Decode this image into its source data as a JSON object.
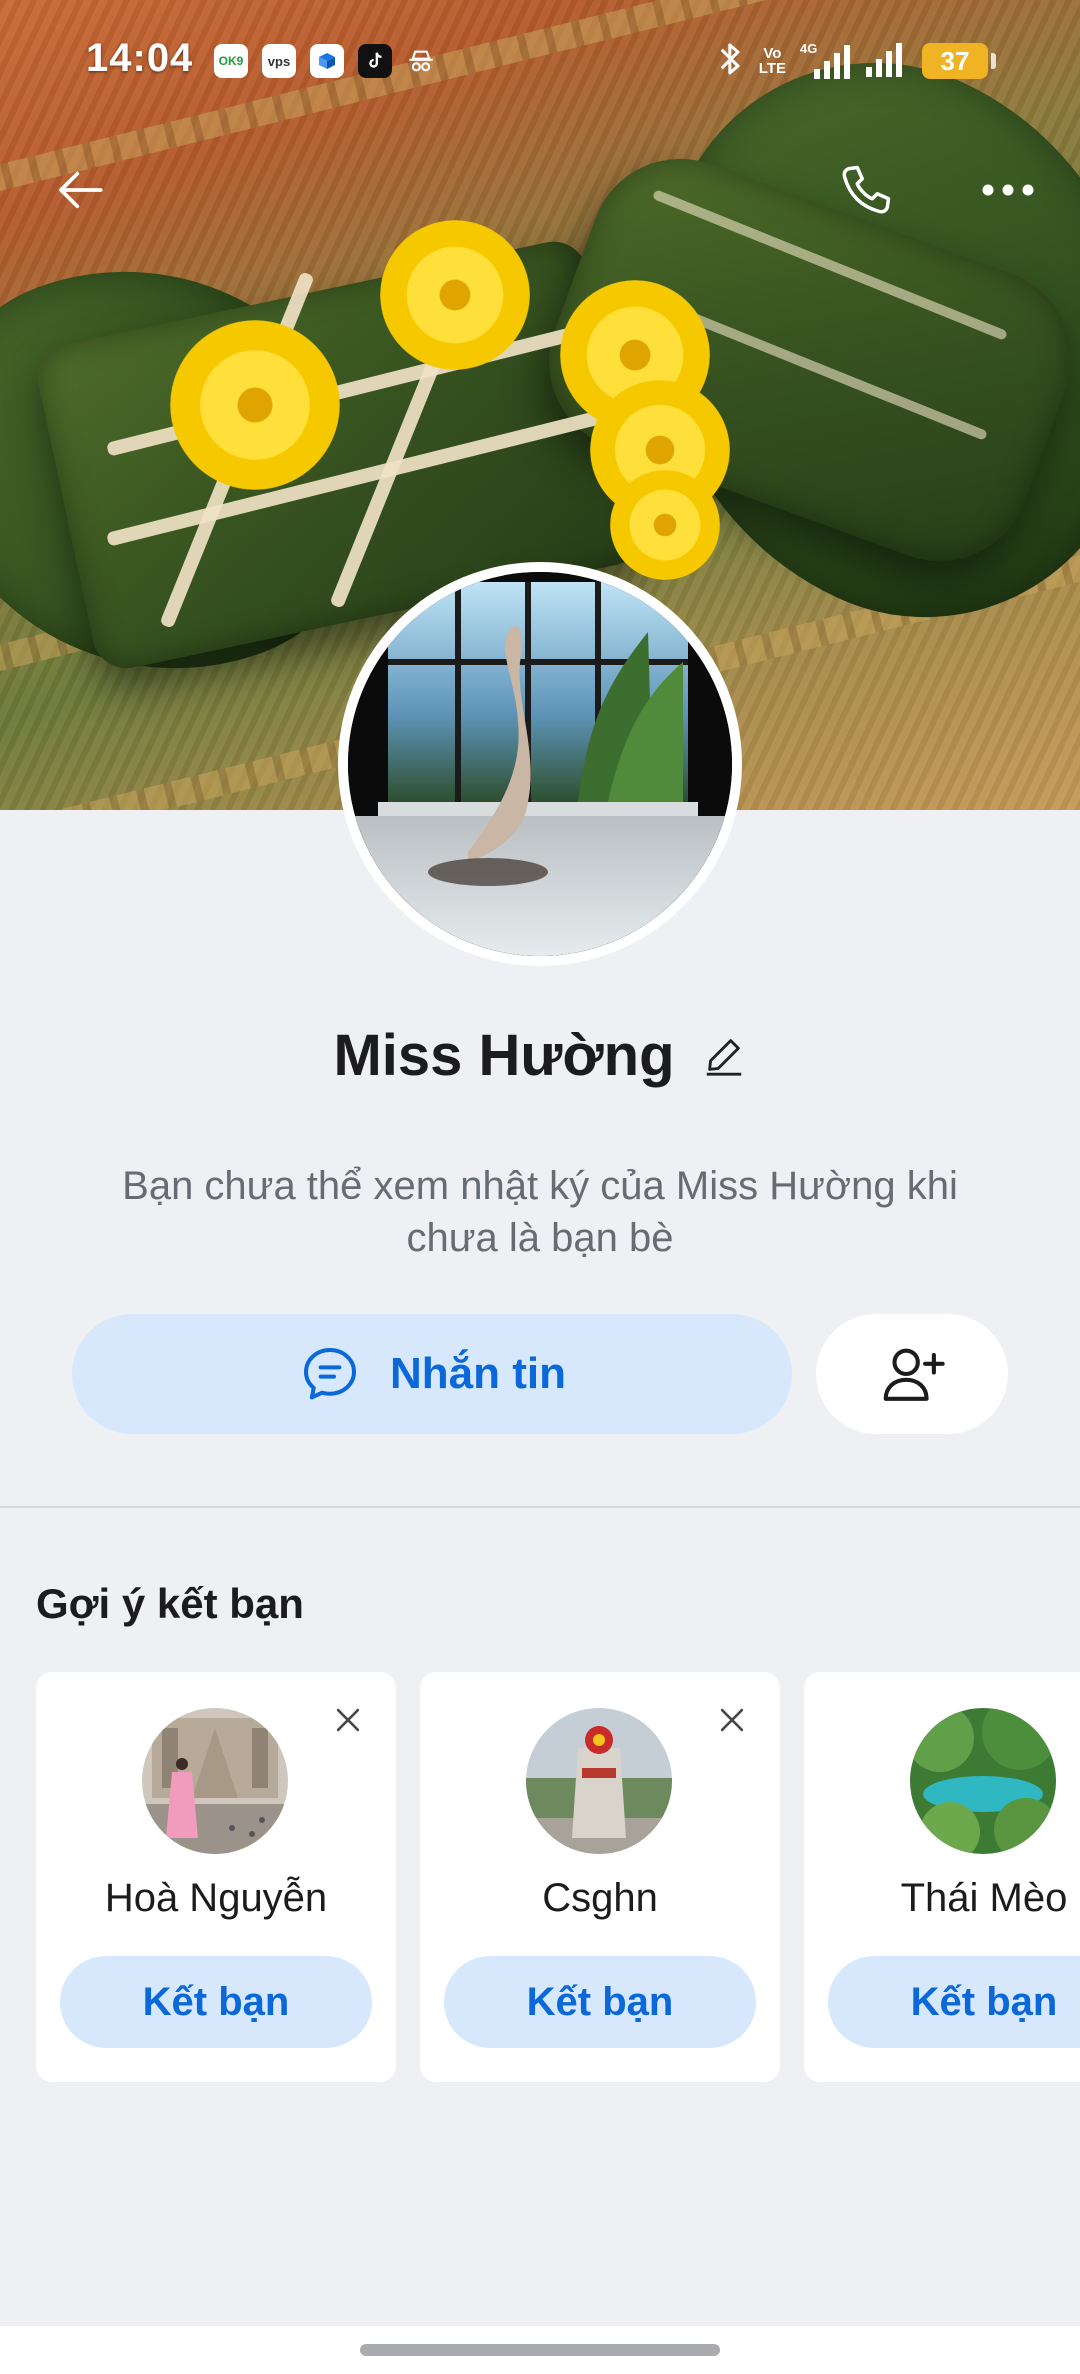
{
  "status_bar": {
    "time": "14:04",
    "notification_icons": [
      "ok9-app-icon",
      "vps-app-icon",
      "box-app-icon",
      "tiktok-icon",
      "incognito-icon"
    ],
    "ok9_label": "OK9",
    "vps_label": "vps",
    "volte_label_1": "Vo",
    "volte_label_2": "LTE",
    "network_label": "4G",
    "battery": "37"
  },
  "profile": {
    "name": "Miss Hường",
    "privacy_note": "Bạn chưa thể xem nhật ký của Miss Hường khi chưa là bạn bè"
  },
  "actions": {
    "message_label": "Nhắn tin"
  },
  "suggestions": {
    "title": "Gợi ý kết bạn",
    "items": [
      {
        "name": "Hoà Nguyễn",
        "button": "Kết bạn"
      },
      {
        "name": "Csghn",
        "button": "Kết bạn"
      },
      {
        "name": "Thái Mèo",
        "button": "Kết bạn"
      }
    ]
  },
  "colors": {
    "accent": "#0a68d8",
    "accent_light": "#d7e8fc",
    "background": "#eef0f3",
    "battery": "#f0b323"
  }
}
